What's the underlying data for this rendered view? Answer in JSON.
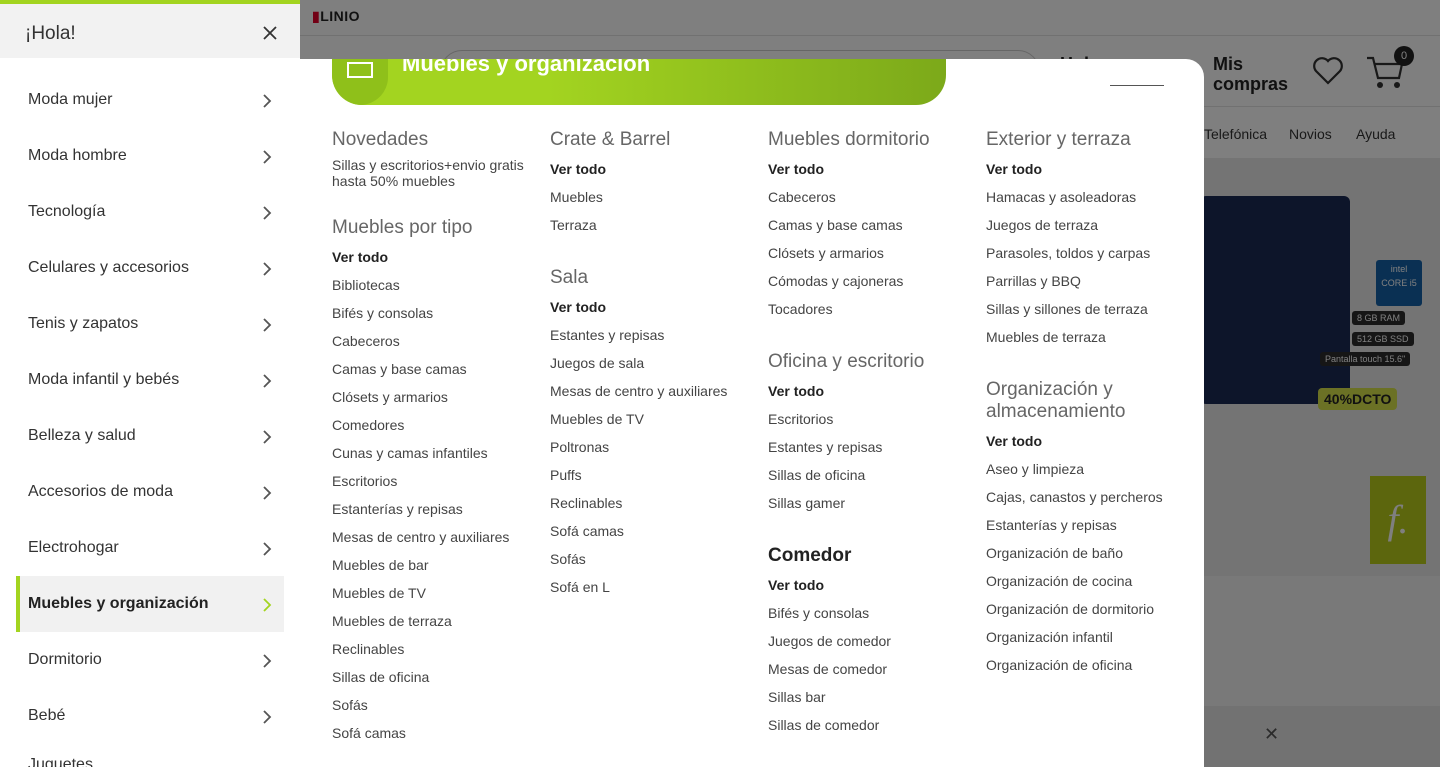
{
  "background": {
    "logo": "LINIO",
    "header_partial_text": "Hola",
    "mis_compras": "Mis compras",
    "cart_count": "0",
    "nav_items": [
      "Telefónica",
      "Novios",
      "Ayuda"
    ],
    "banner_badges": [
      "8 GB RAM",
      "512 GB SSD",
      "Pantalla touch 15.6\""
    ],
    "banner_chip": "intel CORE i5",
    "banner_discount": "40%DCTO",
    "brand_mark": "f."
  },
  "drawer": {
    "title": "¡Hola!",
    "items": [
      {
        "label": "Moda mujer"
      },
      {
        "label": "Moda hombre"
      },
      {
        "label": "Tecnología"
      },
      {
        "label": "Celulares y accesorios"
      },
      {
        "label": "Tenis y zapatos"
      },
      {
        "label": "Moda infantil y bebés"
      },
      {
        "label": "Belleza y salud"
      },
      {
        "label": "Accesorios de moda"
      },
      {
        "label": "Electrohogar"
      },
      {
        "label": "Muebles y organización"
      },
      {
        "label": "Dormitorio"
      },
      {
        "label": "Bebé"
      }
    ],
    "active_index": 9,
    "cut_label": "Juguetes"
  },
  "panel": {
    "banner_title": "Muebles y organización",
    "columns": [
      [
        {
          "title": "Novedades",
          "note": "Sillas y escritorios+envio gratis hasta 50% muebles",
          "items": []
        },
        {
          "title": "Muebles por tipo",
          "items": [
            "Ver todo",
            "Bibliotecas",
            "Bifés y consolas",
            "Cabeceros",
            "Camas y base camas",
            "Clósets y armarios",
            "Comedores",
            "Cunas y camas infantiles",
            "Escritorios",
            "Estanterías y repisas",
            "Mesas de centro y auxiliares",
            "Muebles de bar",
            "Muebles de TV",
            "Muebles de terraza",
            "Reclinables",
            "Sillas de oficina",
            "Sofás",
            "Sofá camas"
          ]
        }
      ],
      [
        {
          "title": "Crate & Barrel",
          "items": [
            "Ver todo",
            "Muebles",
            "Terraza"
          ]
        },
        {
          "title": "Sala",
          "items": [
            "Ver todo",
            "Estantes y repisas",
            "Juegos de sala",
            "Mesas de centro y auxiliares",
            "Muebles de TV",
            "Poltronas",
            "Puffs",
            "Reclinables",
            "Sofá camas",
            "Sofás",
            "Sofá en L"
          ]
        }
      ],
      [
        {
          "title": "Muebles dormitorio",
          "items": [
            "Ver todo",
            "Cabeceros",
            "Camas y base camas",
            "Clósets y armarios",
            "Cómodas y cajoneras",
            "Tocadores"
          ]
        },
        {
          "title": "Oficina y escritorio",
          "items": [
            "Ver todo",
            "Escritorios",
            "Estantes y repisas",
            "Sillas de oficina",
            "Sillas gamer"
          ]
        },
        {
          "title": "Comedor",
          "dark": true,
          "items": [
            "Ver todo",
            "Bifés y consolas",
            "Juegos de comedor",
            "Mesas de comedor",
            "Sillas bar",
            "Sillas de comedor"
          ]
        }
      ],
      [
        {
          "title": "Exterior y terraza",
          "items": [
            "Ver todo",
            "Hamacas y asoleadoras",
            "Juegos de terraza",
            "Parasoles, toldos y carpas",
            "Parrillas y BBQ",
            "Sillas y sillones de terraza",
            "Muebles de terraza"
          ]
        },
        {
          "title": "Organización y almacenamiento",
          "items": [
            "Ver todo",
            "Aseo y limpieza",
            "Cajas, canastos y percheros",
            "Estanterías y repisas",
            "Organización de baño",
            "Organización de cocina",
            "Organización de dormitorio",
            "Organización infantil",
            "Organización de oficina"
          ]
        }
      ]
    ]
  },
  "colors": {
    "accent": "#a3d420",
    "overlay": "rgba(0,0,0,0.5)",
    "text_dark": "#222222",
    "title_gray": "#666666"
  },
  "icons": {
    "close": "close-icon",
    "chevron": "chevron-right-icon",
    "heart": "heart-icon",
    "cart": "cart-icon",
    "banner": "furniture-icon"
  }
}
